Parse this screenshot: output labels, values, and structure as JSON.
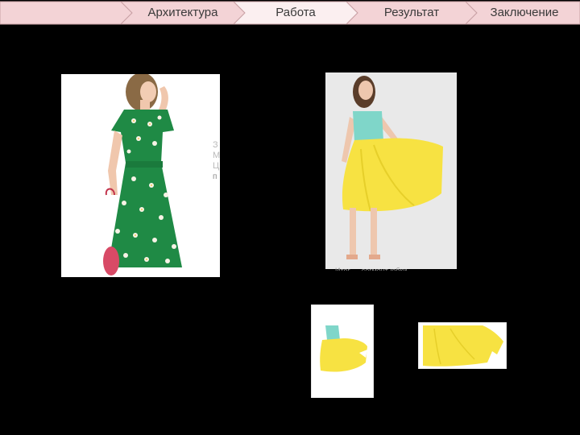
{
  "nav": {
    "tabs": [
      {
        "label": ""
      },
      {
        "label": "Архитектура"
      },
      {
        "label": "Работа"
      },
      {
        "label": "Результат"
      },
      {
        "label": "Заключение"
      }
    ],
    "active_index": 2,
    "colors": {
      "inactive": "#f3d3d6",
      "active": "#fbeff0",
      "border": "#c9a0a4",
      "text": "#3a3a3a"
    }
  },
  "side_text": {
    "line1": "З",
    "line2": "М",
    "line3": "Ц",
    "line4": "п"
  },
  "caption": {
    "text": "Итог — сегмент юбки"
  },
  "images": {
    "green_dress": "photo of woman in green floral dress with red bag",
    "yellow_skirt": "photo of woman in turquoise top and yellow skirt",
    "segment_full": "segmented top and skirt on white",
    "segment_skirt": "segmented yellow skirt on white"
  }
}
